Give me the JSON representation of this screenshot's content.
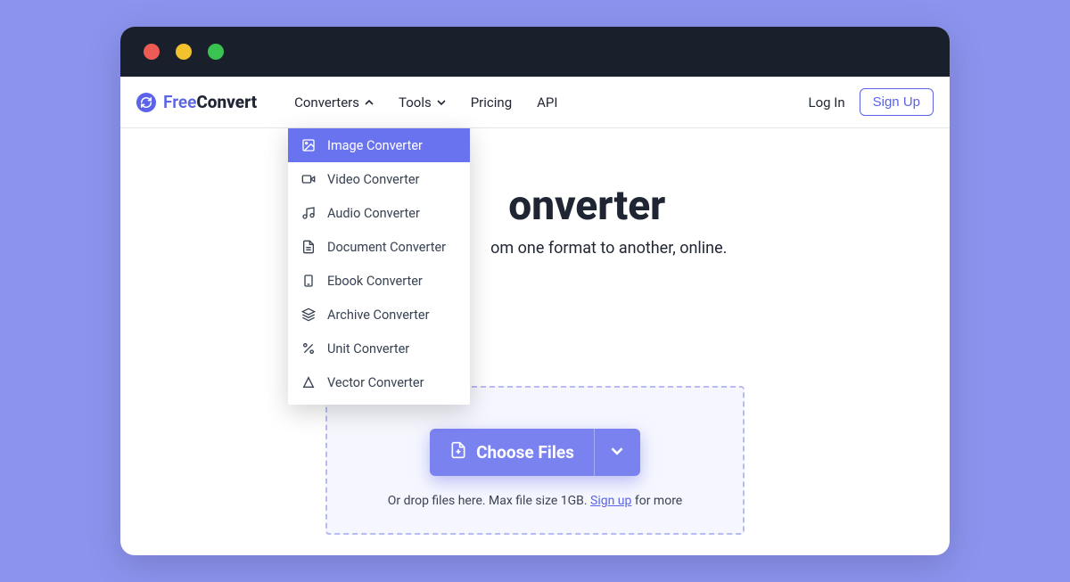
{
  "brand": {
    "part1": "Free",
    "part2": "Convert"
  },
  "nav": {
    "converters": "Converters",
    "tools": "Tools",
    "pricing": "Pricing",
    "api": "API",
    "login": "Log In",
    "signup": "Sign Up"
  },
  "dropdown": {
    "items": [
      {
        "label": "Image Converter",
        "icon": "image"
      },
      {
        "label": "Video Converter",
        "icon": "video"
      },
      {
        "label": "Audio Converter",
        "icon": "audio"
      },
      {
        "label": "Document Converter",
        "icon": "document"
      },
      {
        "label": "Ebook Converter",
        "icon": "ebook"
      },
      {
        "label": "Archive Converter",
        "icon": "archive"
      },
      {
        "label": "Unit Converter",
        "icon": "unit"
      },
      {
        "label": "Vector Converter",
        "icon": "vector"
      }
    ]
  },
  "hero": {
    "title_fragment": "onverter",
    "subtitle_fragment": "om one format to another, online."
  },
  "dropzone": {
    "choose_label": "Choose Files",
    "hint_pre": "Or drop files here. Max file size 1GB. ",
    "hint_link": "Sign up",
    "hint_post": " for more"
  }
}
